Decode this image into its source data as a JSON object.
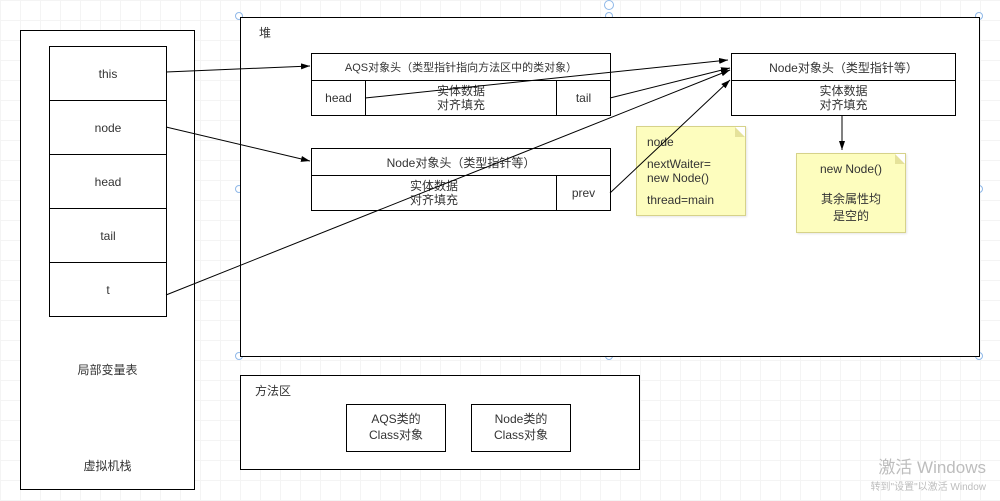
{
  "stack": {
    "title": "局部变量表",
    "footer": "虚拟机栈",
    "vars": [
      "this",
      "node",
      "head",
      "tail",
      "t"
    ]
  },
  "heap": {
    "title": "堆",
    "aqs": {
      "header": "AQS对象头（类型指针指向方法区中的类对象）",
      "body_line1": "实体数据",
      "body_line2": "对齐填充",
      "field_head": "head",
      "field_tail": "tail"
    },
    "node2": {
      "header": "Node对象头（类型指针等）",
      "body_line1": "实体数据",
      "body_line2": "对齐填充",
      "field_prev": "prev"
    },
    "node1": {
      "header": "Node对象头（类型指针等）",
      "body_line1": "实体数据",
      "body_line2": "对齐填充"
    },
    "note_left": {
      "l1": "node",
      "l2": "nextWaiter=",
      "l3": "new Node()",
      "l4": "thread=main"
    },
    "note_right": {
      "l1": "new Node()",
      "l2": "其余属性均",
      "l3": "是空的"
    }
  },
  "method_area": {
    "title": "方法区",
    "cls_aqs_l1": "AQS类的",
    "cls_aqs_l2": "Class对象",
    "cls_node_l1": "Node类的",
    "cls_node_l2": "Class对象"
  },
  "watermark": {
    "line1": "激活 Windows",
    "line2": "转到\"设置\"以激活 Window"
  }
}
